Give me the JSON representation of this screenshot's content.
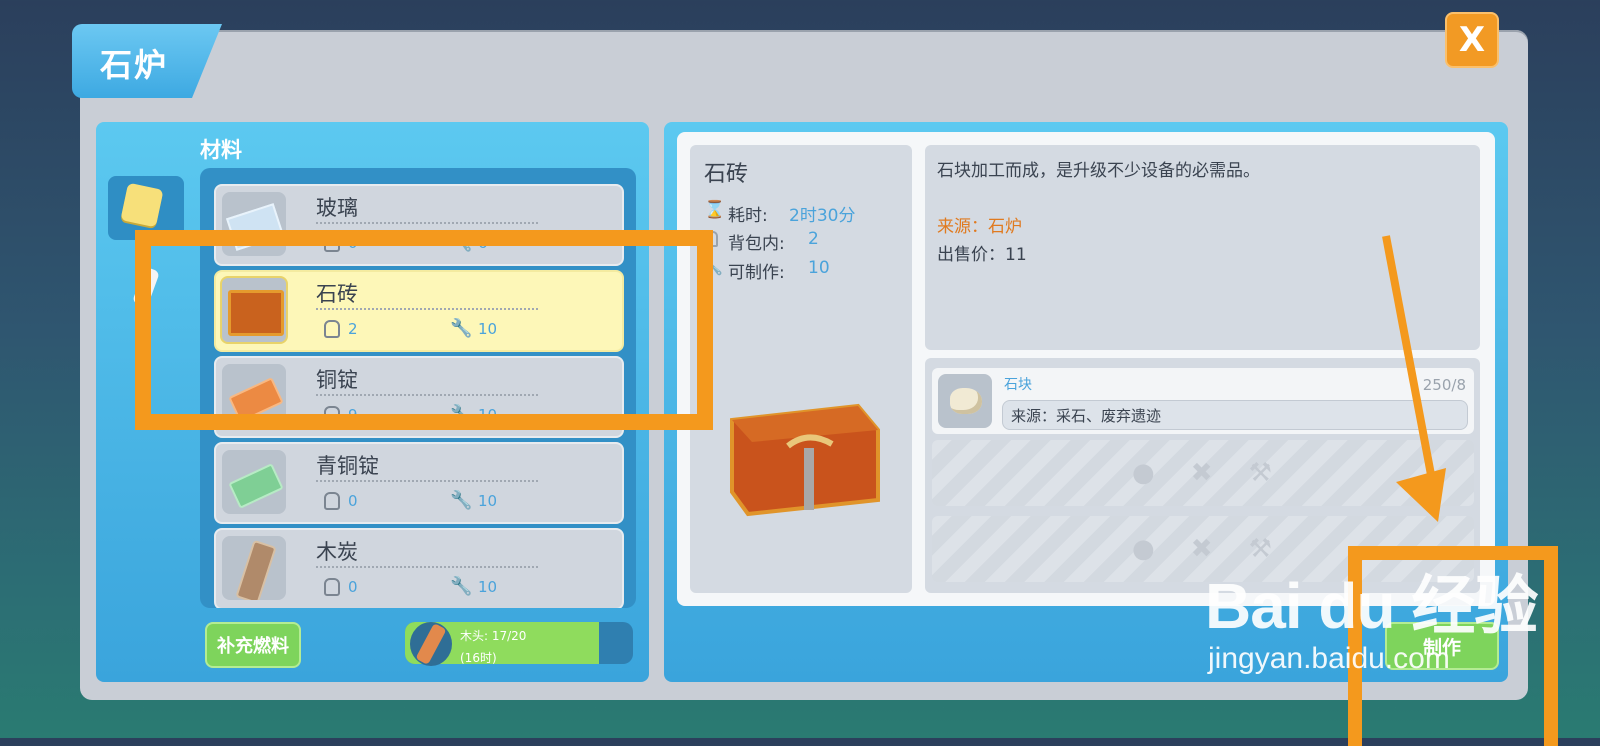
{
  "window": {
    "title": "石炉",
    "close_label": "X"
  },
  "category": {
    "title": "材料"
  },
  "items": [
    {
      "name": "玻璃",
      "bag": "0",
      "craftable": "6"
    },
    {
      "name": "石砖",
      "bag": "2",
      "craftable": "10"
    },
    {
      "name": "铜锭",
      "bag": "9",
      "craftable": "10"
    },
    {
      "name": "青铜锭",
      "bag": "0",
      "craftable": "10"
    },
    {
      "name": "木炭",
      "bag": "0",
      "craftable": "10"
    }
  ],
  "fuel": {
    "button": "补充燃料",
    "label": "木头: 17/20",
    "time": "(16时)",
    "fill_fraction": 0.85
  },
  "detail": {
    "name": "石砖",
    "time_label": "耗时:",
    "time_value": "2时30分",
    "bag_label": "背包内:",
    "bag_value": "2",
    "craft_label": "可制作:",
    "craft_value": "10",
    "description": "石块加工而成，是升级不少设备的必需品。",
    "source": "来源：石炉",
    "price": "出售价：11"
  },
  "materials": [
    {
      "name": "石块",
      "count": "250/8",
      "source": "来源：采石、废弃遗迹"
    }
  ],
  "make_button": "制作",
  "watermark": {
    "brand": "Bai du 经验",
    "url": "jingyan.baidu.com"
  },
  "colors": {
    "accent": "#f4991d",
    "panel": "#4fbaea",
    "selected": "#fdf7b8",
    "button": "#7ed45c"
  }
}
